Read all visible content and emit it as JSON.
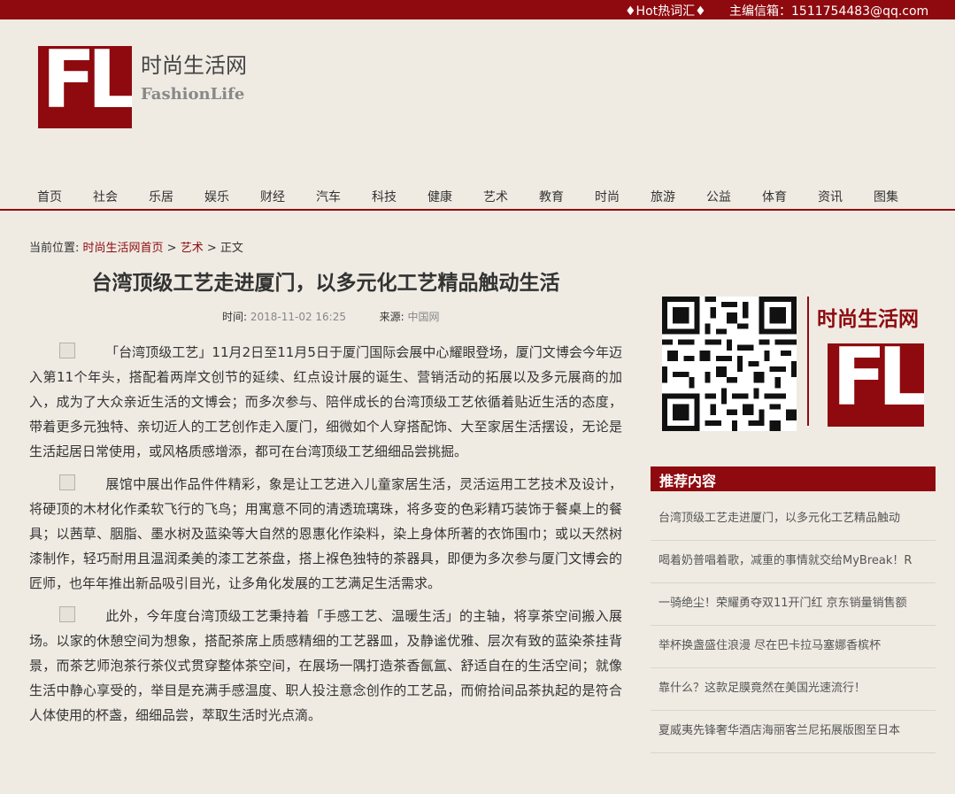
{
  "topbar": {
    "hot": "♦Hot热词汇♦",
    "mail": "主编信箱：1511754483@qq.com"
  },
  "logo": {
    "letters": "FL",
    "name_cn": "时尚生活网",
    "name_en": "FashionLife"
  },
  "nav": [
    "首页",
    "社会",
    "乐居",
    "娱乐",
    "财经",
    "汽车",
    "科技",
    "健康",
    "艺术",
    "教育",
    "时尚",
    "旅游",
    "公益",
    "体育",
    "资讯",
    "图集"
  ],
  "breadcrumb": {
    "prefix": "当前位置: ",
    "home": "时尚生活网首页",
    "sep": " > ",
    "category": "艺术",
    "current": "正文"
  },
  "article": {
    "title": "台湾顶级工艺走进厦门，以多元化工艺精品触动生活",
    "time_label": "时间: ",
    "time": "2018-11-02 16:25",
    "source_label": "来源: ",
    "source": "中国网",
    "paragraphs": [
      "「台湾顶级工艺」11月2日至11月5日于厦门国际会展中心耀眼登场，厦门文博会今年迈入第11个年头，搭配着两岸文创节的延续、红点设计展的诞生、营销活动的拓展以及多元展商的加入，成为了大众亲近生活的文博会；而多次参与、陪伴成长的台湾顶级工艺依循着贴近生活的态度，带着更多元独特、亲切近人的工艺创作走入厦门，细微如个人穿搭配饰、大至家居生活摆设，无论是生活起居日常使用，或风格质感增添，都可在台湾顶级工艺细细品尝挑掘。",
      "展馆中展出作品件件精彩，象是让工艺进入儿童家居生活，灵活运用工艺技术及设计，将硬顶的木材化作柔软飞行的飞鸟；用寓意不同的清透琉璃珠，将多变的色彩精巧装饰于餐桌上的餐具；以茜草、胭脂、墨水树及蓝染等大自然的恩惠化作染料，染上身体所著的衣饰围巾；或以天然树漆制作，轻巧耐用且温润柔美的漆工艺茶盘，搭上褓色独特的茶器具，即便为多次参与厦门文博会的匠师，也年年推出新品吸引目光，让多角化发展的工艺满足生活需求。",
      "此外，今年度台湾顶级工艺秉持着「手感工艺、温暖生活」的主轴，将享茶空间搬入展场。以家的休憩空间为想象，搭配茶席上质感精细的工艺器皿，及静谧优雅、层次有致的蓝染茶挂背景，而茶艺师泡茶行茶仪式贯穿整体茶空间，在展场一隅打造茶香氤氲、舒适自在的生活空间；就像生活中静心享受的，举目是充满手感温度、职人投注意念创作的工艺品，而俯拾间品茶执起的是符合人体使用的杯盏，细细品尝，萃取生活时光点滴。"
    ]
  },
  "sidebar": {
    "name_cn": "时尚生活网",
    "logo_letters": "FL",
    "rec_title": "推荐内容",
    "rec_items": [
      "台湾顶级工艺走进厦门，以多元化工艺精品触动",
      "喝着奶普唱着歌，减重的事情就交给MyBreak！R",
      "一骑绝尘！荣耀勇夺双11开门红 京东销量销售额",
      "举杯换盏盛住浪漫 尽在巴卡拉马塞娜香槟杯",
      "靠什么？这款足膜竟然在美国光速流行！",
      "夏威夷先锋奢华酒店海丽客兰尼拓展版图至日本"
    ]
  },
  "colors": {
    "brand": "#8e0a0f",
    "background": "#efebe3"
  }
}
